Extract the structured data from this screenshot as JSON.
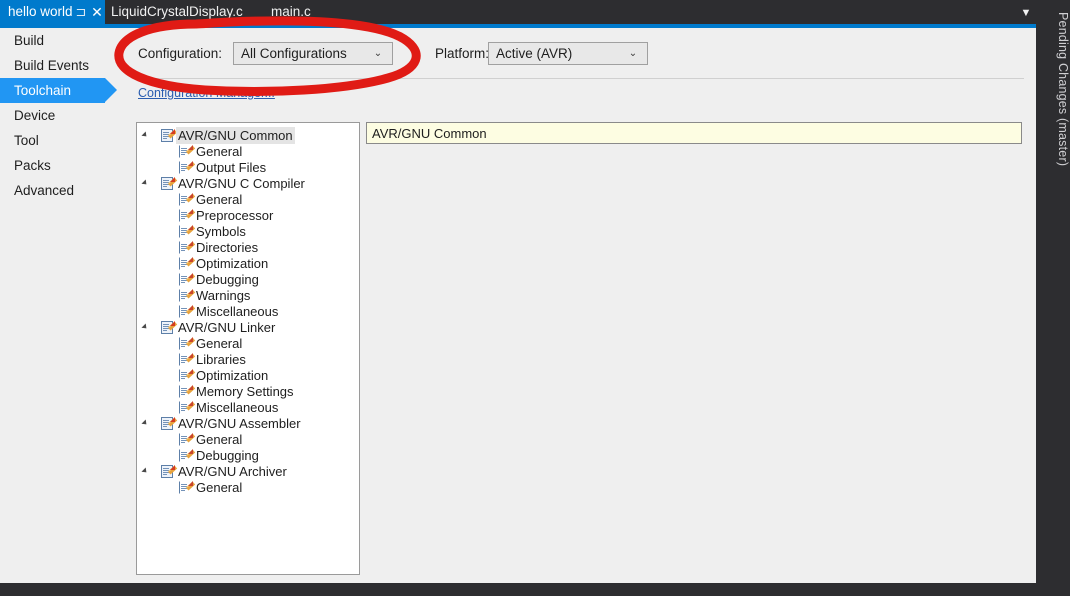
{
  "window": {
    "tabs": [
      {
        "label": "hello world",
        "active": true,
        "pin_icon": "⊐",
        "close_icon": "✕"
      },
      {
        "label": "LiquidCrystalDisplay.c",
        "active": false
      },
      {
        "label": "main.c",
        "active": false
      }
    ],
    "tab_overflow_icon": "▼",
    "right_dock_label": "Pending Changes (master)"
  },
  "sidebar": {
    "items": [
      {
        "label": "Build",
        "selected": false
      },
      {
        "label": "Build Events",
        "selected": false
      },
      {
        "label": "Toolchain",
        "selected": true
      },
      {
        "label": "Device",
        "selected": false
      },
      {
        "label": "Tool",
        "selected": false
      },
      {
        "label": "Packs",
        "selected": false
      },
      {
        "label": "Advanced",
        "selected": false
      }
    ]
  },
  "toolbar": {
    "configuration_label": "Configuration:",
    "configuration_value": "All Configurations",
    "platform_label": "Platform:",
    "platform_value": "Active (AVR)",
    "chevron_icon": "⌄",
    "configuration_manager_link": "Configuration Manager..."
  },
  "tree": {
    "nodes": [
      {
        "label": "AVR/GNU Common",
        "level": 0,
        "expanded": true,
        "selected": true
      },
      {
        "label": "General",
        "level": 1
      },
      {
        "label": "Output Files",
        "level": 1
      },
      {
        "label": "AVR/GNU C Compiler",
        "level": 0,
        "expanded": true
      },
      {
        "label": "General",
        "level": 1
      },
      {
        "label": "Preprocessor",
        "level": 1
      },
      {
        "label": "Symbols",
        "level": 1
      },
      {
        "label": "Directories",
        "level": 1
      },
      {
        "label": "Optimization",
        "level": 1
      },
      {
        "label": "Debugging",
        "level": 1
      },
      {
        "label": "Warnings",
        "level": 1
      },
      {
        "label": "Miscellaneous",
        "level": 1
      },
      {
        "label": "AVR/GNU Linker",
        "level": 0,
        "expanded": true
      },
      {
        "label": "General",
        "level": 1
      },
      {
        "label": "Libraries",
        "level": 1
      },
      {
        "label": "Optimization",
        "level": 1
      },
      {
        "label": "Memory Settings",
        "level": 1
      },
      {
        "label": "Miscellaneous",
        "level": 1
      },
      {
        "label": "AVR/GNU Assembler",
        "level": 0,
        "expanded": true
      },
      {
        "label": "General",
        "level": 1
      },
      {
        "label": "Debugging",
        "level": 1
      },
      {
        "label": "AVR/GNU Archiver",
        "level": 0,
        "expanded": true
      },
      {
        "label": "General",
        "level": 1
      }
    ]
  },
  "content": {
    "header_title": "AVR/GNU Common"
  },
  "annotation": {
    "shape": "hand-drawn-red-ellipse",
    "color": "#e01b15"
  },
  "colors": {
    "accent_blue": "#007acc",
    "tab_active": "#007acc",
    "sidebar_selected": "#2196f3",
    "dark_chrome": "#2d2d30",
    "panel_bg": "#efefef",
    "content_header_bg": "#fdfde2",
    "link": "#2a5db0",
    "annotation_red": "#e01b15"
  }
}
